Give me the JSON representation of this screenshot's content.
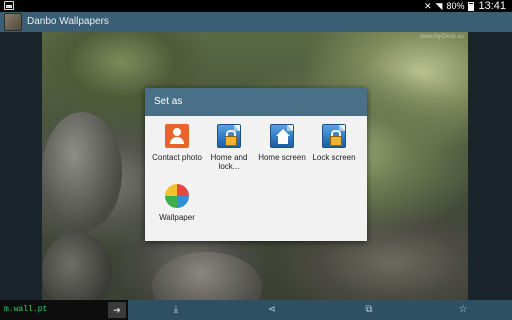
{
  "status_bar": {
    "battery": "80%",
    "time": "13:41"
  },
  "app": {
    "title": "Danbo Wallpapers"
  },
  "photo": {
    "watermark": "www.fiqrDesk.es"
  },
  "dialog": {
    "title": "Set as",
    "options": [
      {
        "label": "Contact photo",
        "icon": "contact-icon"
      },
      {
        "label": "Home and lock...",
        "icon": "home-lock-icon"
      },
      {
        "label": "Home screen",
        "icon": "home-screen-icon"
      },
      {
        "label": "Lock screen",
        "icon": "lock-screen-icon"
      },
      {
        "label": "Wallpaper",
        "icon": "pinwheel-icon"
      }
    ]
  },
  "bottom_bar": {
    "url": "m.wall.pt",
    "go_label": "➔",
    "actions": [
      "download-icon",
      "share-icon",
      "crop-icon",
      "star-icon"
    ],
    "glyphs": [
      "⤓",
      "⋖",
      "⧉",
      "☆"
    ]
  },
  "colors": {
    "action_bar": "#3a5f74",
    "dialog_header": "#4a7088",
    "bottom_bar": "#2f4f63",
    "url_text": "#2fd36b"
  }
}
